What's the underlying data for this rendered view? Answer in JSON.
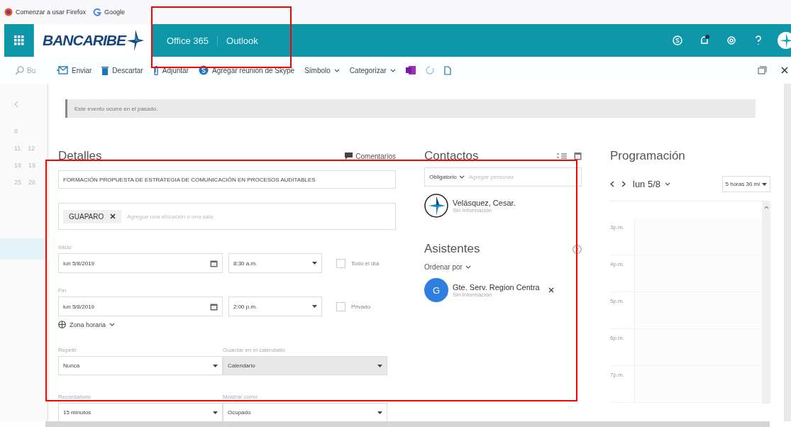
{
  "bookmarks": [
    {
      "label": "Comenzar a usar Firefox",
      "kind": "firefox"
    },
    {
      "label": "Google",
      "kind": "google"
    }
  ],
  "header": {
    "logo": "BANCARIBE",
    "links": [
      "Office 365",
      "Outlook"
    ],
    "highlighted": true
  },
  "toolbar": {
    "search_text": "Bu",
    "actions": [
      {
        "label": "Enviar",
        "kind": "send"
      },
      {
        "label": "Descartar",
        "kind": "trash"
      },
      {
        "label": "Adjuntar",
        "kind": "clip"
      },
      {
        "label": "Agregar reunión de Skype",
        "kind": "skype"
      },
      {
        "label": "Símbolo",
        "kind": "menu"
      },
      {
        "label": "Categorizar",
        "kind": "menu"
      }
    ]
  },
  "left_pane": {
    "rows": [
      [
        "8"
      ],
      [
        "11",
        "12"
      ],
      [
        "18",
        "19"
      ],
      [
        "25",
        "26"
      ]
    ]
  },
  "notice": "Este evento ocurre en el pasado.",
  "details": {
    "heading": "Detalles",
    "comments": "Comentarios",
    "highlighted": true,
    "title": "FORMACIÓN PROPUESTA DE ESTRATEGIA DE COMUNICACIÓN EN PROCESOS AUDITABLES",
    "location_chip": "GUAPARO",
    "location_placeholder": "Agregue una ubicación o una sala",
    "start_label": "Inicio",
    "start_date": "lun 5/8/2019",
    "start_time": "8:30 a.m.",
    "all_day": {
      "label": "Todo el día",
      "checked": false
    },
    "end_label": "Fin",
    "end_date": "lun 5/8/2019",
    "end_time": "2:00 p.m.",
    "private": {
      "label": "Privado",
      "checked": false
    },
    "timezone": "Zona horaria",
    "repeat_label": "Repetir",
    "repeat": "Nunca",
    "calendar_label": "Guardar en el calendario",
    "calendar": "Calendario",
    "calendar_disabled": true,
    "reminder_label": "Recordatorio",
    "reminder": "15 minutos",
    "show_as_label": "Mostrar como",
    "show_as": "Ocupado"
  },
  "contacts": {
    "heading": "Contactos",
    "required": "Obligatorio",
    "placeholder": "Agregar personas",
    "organizer": {
      "name": "Velásquez, Cesar.",
      "status": "Sin información"
    },
    "attendees_heading": "Asistentes",
    "sort": "Ordenar por",
    "attendees": [
      {
        "initial": "G",
        "name": "Gte. Serv. Region Centra",
        "status": "Sin información",
        "color": "#2f7fe0"
      }
    ]
  },
  "schedule": {
    "heading": "Programación",
    "date": "lun 5/8",
    "duration": "5 horas 30 mi",
    "hours": [
      "3p.m.",
      "4p.m.",
      "5p.m.",
      "6p.m.",
      "7p.m."
    ]
  }
}
